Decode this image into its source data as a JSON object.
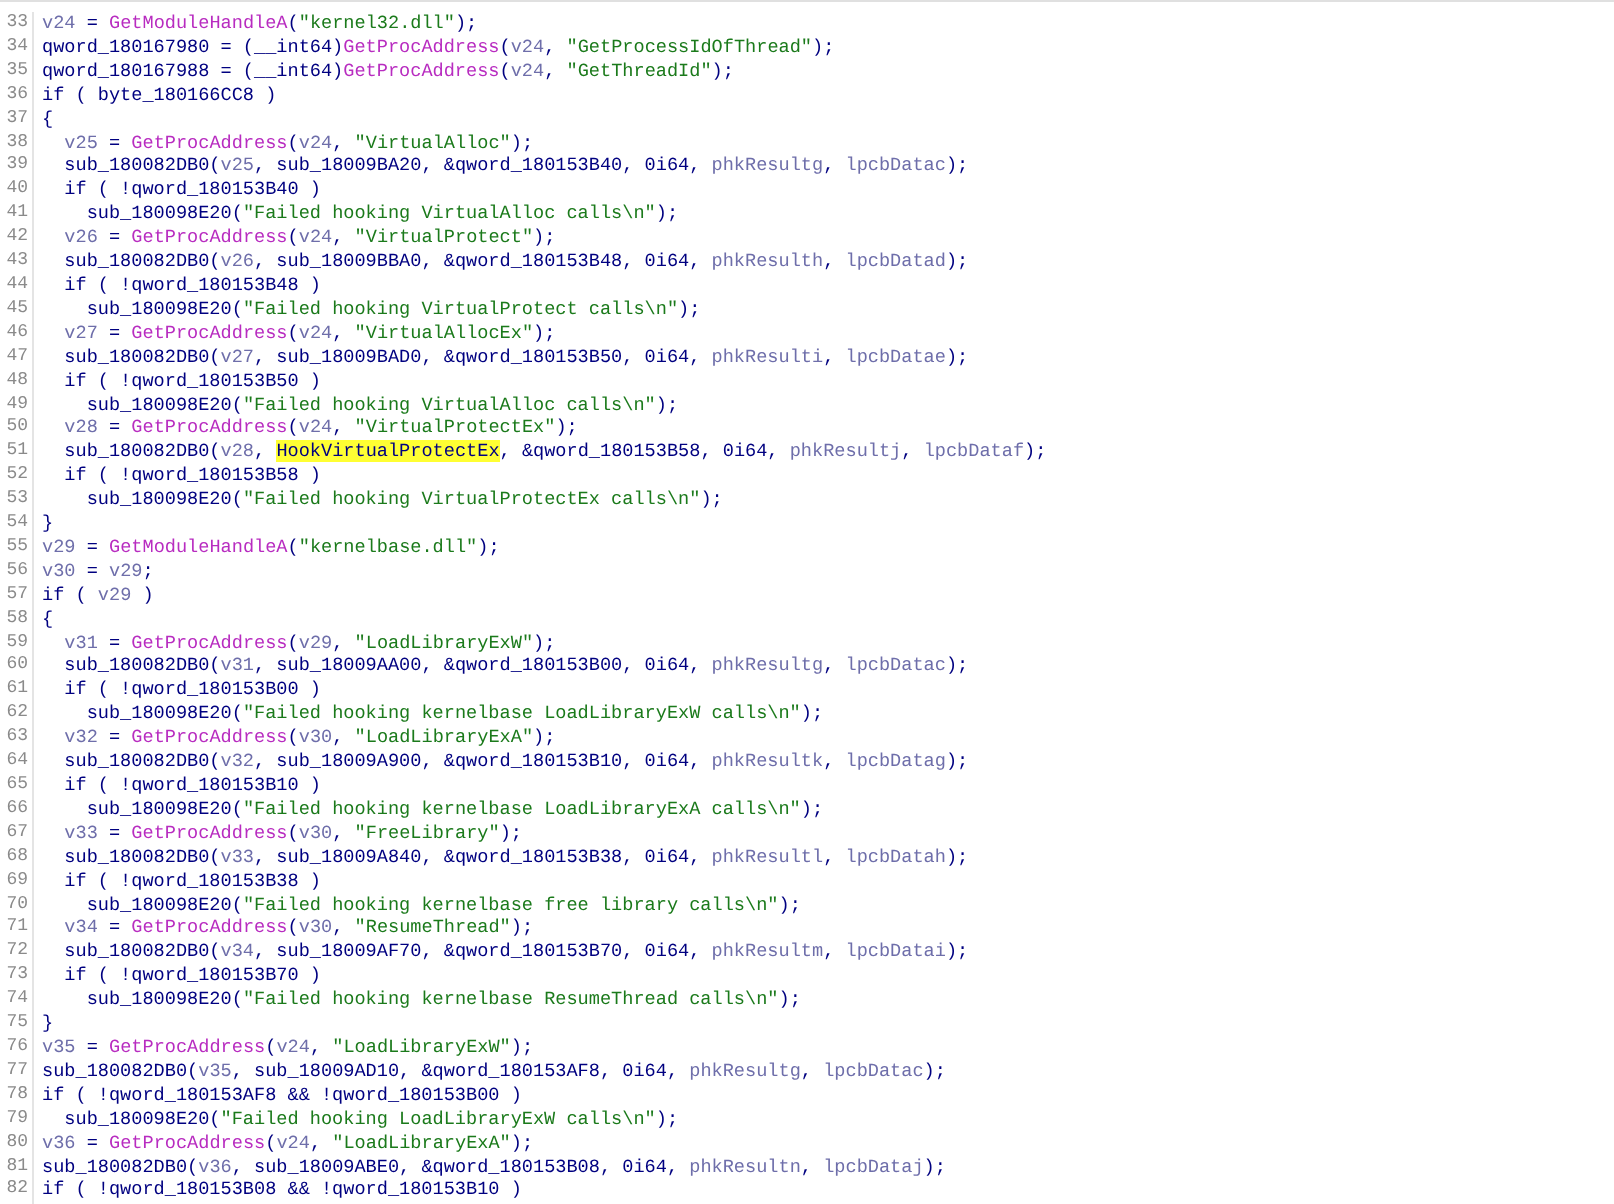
{
  "lines": [
    {
      "number": "33",
      "tokens": [
        {
          "kind": "local",
          "text": "v24"
        },
        {
          "kind": "plain",
          "text": " = "
        },
        {
          "kind": "func",
          "text": "GetModuleHandleA"
        },
        {
          "kind": "plain",
          "text": "("
        },
        {
          "kind": "string",
          "text": "\"kernel32.dll\""
        },
        {
          "kind": "plain",
          "text": ");"
        }
      ]
    },
    {
      "number": "34",
      "tokens": [
        {
          "kind": "plain",
          "text": "qword_180167980 = (__int64)"
        },
        {
          "kind": "func",
          "text": "GetProcAddress"
        },
        {
          "kind": "plain",
          "text": "("
        },
        {
          "kind": "local",
          "text": "v24"
        },
        {
          "kind": "plain",
          "text": ", "
        },
        {
          "kind": "string",
          "text": "\"GetProcessIdOfThread\""
        },
        {
          "kind": "plain",
          "text": ");"
        }
      ]
    },
    {
      "number": "35",
      "tokens": [
        {
          "kind": "plain",
          "text": "qword_180167988 = (__int64)"
        },
        {
          "kind": "func",
          "text": "GetProcAddress"
        },
        {
          "kind": "plain",
          "text": "("
        },
        {
          "kind": "local",
          "text": "v24"
        },
        {
          "kind": "plain",
          "text": ", "
        },
        {
          "kind": "string",
          "text": "\"GetThreadId\""
        },
        {
          "kind": "plain",
          "text": ");"
        }
      ]
    },
    {
      "number": "36",
      "tokens": [
        {
          "kind": "plain",
          "text": "if ( byte_180166CC8 )"
        }
      ]
    },
    {
      "number": "37",
      "tokens": [
        {
          "kind": "plain",
          "text": "{"
        }
      ]
    },
    {
      "number": "38",
      "tokens": [
        {
          "kind": "local",
          "text": "  v25"
        },
        {
          "kind": "plain",
          "text": " = "
        },
        {
          "kind": "func",
          "text": "GetProcAddress"
        },
        {
          "kind": "plain",
          "text": "("
        },
        {
          "kind": "local",
          "text": "v24"
        },
        {
          "kind": "plain",
          "text": ", "
        },
        {
          "kind": "string",
          "text": "\"VirtualAlloc\""
        },
        {
          "kind": "plain",
          "text": ");"
        }
      ]
    },
    {
      "number": "39",
      "tokens": [
        {
          "kind": "plain",
          "text": "  sub_180082DB0("
        },
        {
          "kind": "local",
          "text": "v25"
        },
        {
          "kind": "plain",
          "text": ", sub_18009BA20, &qword_180153B40, 0i64, "
        },
        {
          "kind": "local",
          "text": "phkResultg"
        },
        {
          "kind": "plain",
          "text": ", "
        },
        {
          "kind": "local",
          "text": "lpcbDatac"
        },
        {
          "kind": "plain",
          "text": ");"
        }
      ]
    },
    {
      "number": "40",
      "tokens": [
        {
          "kind": "plain",
          "text": "  if ( !qword_180153B40 )"
        }
      ]
    },
    {
      "number": "41",
      "tokens": [
        {
          "kind": "plain",
          "text": "    sub_180098E20("
        },
        {
          "kind": "string",
          "text": "\"Failed hooking VirtualAlloc calls\\n\""
        },
        {
          "kind": "plain",
          "text": ");"
        }
      ]
    },
    {
      "number": "42",
      "tokens": [
        {
          "kind": "local",
          "text": "  v26"
        },
        {
          "kind": "plain",
          "text": " = "
        },
        {
          "kind": "func",
          "text": "GetProcAddress"
        },
        {
          "kind": "plain",
          "text": "("
        },
        {
          "kind": "local",
          "text": "v24"
        },
        {
          "kind": "plain",
          "text": ", "
        },
        {
          "kind": "string",
          "text": "\"VirtualProtect\""
        },
        {
          "kind": "plain",
          "text": ");"
        }
      ]
    },
    {
      "number": "43",
      "tokens": [
        {
          "kind": "plain",
          "text": "  sub_180082DB0("
        },
        {
          "kind": "local",
          "text": "v26"
        },
        {
          "kind": "plain",
          "text": ", sub_18009BBA0, &qword_180153B48, 0i64, "
        },
        {
          "kind": "local",
          "text": "phkResulth"
        },
        {
          "kind": "plain",
          "text": ", "
        },
        {
          "kind": "local",
          "text": "lpcbDatad"
        },
        {
          "kind": "plain",
          "text": ");"
        }
      ]
    },
    {
      "number": "44",
      "tokens": [
        {
          "kind": "plain",
          "text": "  if ( !qword_180153B48 )"
        }
      ]
    },
    {
      "number": "45",
      "tokens": [
        {
          "kind": "plain",
          "text": "    sub_180098E20("
        },
        {
          "kind": "string",
          "text": "\"Failed hooking VirtualProtect calls\\n\""
        },
        {
          "kind": "plain",
          "text": ");"
        }
      ]
    },
    {
      "number": "46",
      "tokens": [
        {
          "kind": "local",
          "text": "  v27"
        },
        {
          "kind": "plain",
          "text": " = "
        },
        {
          "kind": "func",
          "text": "GetProcAddress"
        },
        {
          "kind": "plain",
          "text": "("
        },
        {
          "kind": "local",
          "text": "v24"
        },
        {
          "kind": "plain",
          "text": ", "
        },
        {
          "kind": "string",
          "text": "\"VirtualAllocEx\""
        },
        {
          "kind": "plain",
          "text": ");"
        }
      ]
    },
    {
      "number": "47",
      "tokens": [
        {
          "kind": "plain",
          "text": "  sub_180082DB0("
        },
        {
          "kind": "local",
          "text": "v27"
        },
        {
          "kind": "plain",
          "text": ", sub_18009BAD0, &qword_180153B50, 0i64, "
        },
        {
          "kind": "local",
          "text": "phkResulti"
        },
        {
          "kind": "plain",
          "text": ", "
        },
        {
          "kind": "local",
          "text": "lpcbDatae"
        },
        {
          "kind": "plain",
          "text": ");"
        }
      ]
    },
    {
      "number": "48",
      "tokens": [
        {
          "kind": "plain",
          "text": "  if ( !qword_180153B50 )"
        }
      ]
    },
    {
      "number": "49",
      "tokens": [
        {
          "kind": "plain",
          "text": "    sub_180098E20("
        },
        {
          "kind": "string",
          "text": "\"Failed hooking VirtualAlloc calls\\n\""
        },
        {
          "kind": "plain",
          "text": ");"
        }
      ]
    },
    {
      "number": "50",
      "tokens": [
        {
          "kind": "local",
          "text": "  v28"
        },
        {
          "kind": "plain",
          "text": " = "
        },
        {
          "kind": "func",
          "text": "GetProcAddress"
        },
        {
          "kind": "plain",
          "text": "("
        },
        {
          "kind": "local",
          "text": "v24"
        },
        {
          "kind": "plain",
          "text": ", "
        },
        {
          "kind": "string",
          "text": "\"VirtualProtectEx\""
        },
        {
          "kind": "plain",
          "text": ");"
        }
      ]
    },
    {
      "number": "51",
      "tokens": [
        {
          "kind": "plain",
          "text": "  sub_180082DB0("
        },
        {
          "kind": "local",
          "text": "v28"
        },
        {
          "kind": "plain",
          "text": ", "
        },
        {
          "kind": "highlight",
          "text": "HookVirtualProtectEx"
        },
        {
          "kind": "plain",
          "text": ", &qword_180153B58, 0i64, "
        },
        {
          "kind": "local",
          "text": "phkResultj"
        },
        {
          "kind": "plain",
          "text": ", "
        },
        {
          "kind": "local",
          "text": "lpcbDataf"
        },
        {
          "kind": "plain",
          "text": ");"
        }
      ]
    },
    {
      "number": "52",
      "tokens": [
        {
          "kind": "plain",
          "text": "  if ( !qword_180153B58 )"
        }
      ]
    },
    {
      "number": "53",
      "tokens": [
        {
          "kind": "plain",
          "text": "    sub_180098E20("
        },
        {
          "kind": "string",
          "text": "\"Failed hooking VirtualProtectEx calls\\n\""
        },
        {
          "kind": "plain",
          "text": ");"
        }
      ]
    },
    {
      "number": "54",
      "tokens": [
        {
          "kind": "plain",
          "text": "}"
        }
      ]
    },
    {
      "number": "55",
      "tokens": [
        {
          "kind": "local",
          "text": "v29"
        },
        {
          "kind": "plain",
          "text": " = "
        },
        {
          "kind": "func",
          "text": "GetModuleHandleA"
        },
        {
          "kind": "plain",
          "text": "("
        },
        {
          "kind": "string",
          "text": "\"kernelbase.dll\""
        },
        {
          "kind": "plain",
          "text": ");"
        }
      ]
    },
    {
      "number": "56",
      "tokens": [
        {
          "kind": "local",
          "text": "v30"
        },
        {
          "kind": "plain",
          "text": " = "
        },
        {
          "kind": "local",
          "text": "v29"
        },
        {
          "kind": "plain",
          "text": ";"
        }
      ]
    },
    {
      "number": "57",
      "tokens": [
        {
          "kind": "plain",
          "text": "if ( "
        },
        {
          "kind": "local",
          "text": "v29"
        },
        {
          "kind": "plain",
          "text": " )"
        }
      ]
    },
    {
      "number": "58",
      "tokens": [
        {
          "kind": "plain",
          "text": "{"
        }
      ]
    },
    {
      "number": "59",
      "tokens": [
        {
          "kind": "local",
          "text": "  v31"
        },
        {
          "kind": "plain",
          "text": " = "
        },
        {
          "kind": "func",
          "text": "GetProcAddress"
        },
        {
          "kind": "plain",
          "text": "("
        },
        {
          "kind": "local",
          "text": "v29"
        },
        {
          "kind": "plain",
          "text": ", "
        },
        {
          "kind": "string",
          "text": "\"LoadLibraryExW\""
        },
        {
          "kind": "plain",
          "text": ");"
        }
      ]
    },
    {
      "number": "60",
      "tokens": [
        {
          "kind": "plain",
          "text": "  sub_180082DB0("
        },
        {
          "kind": "local",
          "text": "v31"
        },
        {
          "kind": "plain",
          "text": ", sub_18009AA00, &qword_180153B00, 0i64, "
        },
        {
          "kind": "local",
          "text": "phkResultg"
        },
        {
          "kind": "plain",
          "text": ", "
        },
        {
          "kind": "local",
          "text": "lpcbDatac"
        },
        {
          "kind": "plain",
          "text": ");"
        }
      ]
    },
    {
      "number": "61",
      "tokens": [
        {
          "kind": "plain",
          "text": "  if ( !qword_180153B00 )"
        }
      ]
    },
    {
      "number": "62",
      "tokens": [
        {
          "kind": "plain",
          "text": "    sub_180098E20("
        },
        {
          "kind": "string",
          "text": "\"Failed hooking kernelbase LoadLibraryExW calls\\n\""
        },
        {
          "kind": "plain",
          "text": ");"
        }
      ]
    },
    {
      "number": "63",
      "tokens": [
        {
          "kind": "local",
          "text": "  v32"
        },
        {
          "kind": "plain",
          "text": " = "
        },
        {
          "kind": "func",
          "text": "GetProcAddress"
        },
        {
          "kind": "plain",
          "text": "("
        },
        {
          "kind": "local",
          "text": "v30"
        },
        {
          "kind": "plain",
          "text": ", "
        },
        {
          "kind": "string",
          "text": "\"LoadLibraryExA\""
        },
        {
          "kind": "plain",
          "text": ");"
        }
      ]
    },
    {
      "number": "64",
      "tokens": [
        {
          "kind": "plain",
          "text": "  sub_180082DB0("
        },
        {
          "kind": "local",
          "text": "v32"
        },
        {
          "kind": "plain",
          "text": ", sub_18009A900, &qword_180153B10, 0i64, "
        },
        {
          "kind": "local",
          "text": "phkResultk"
        },
        {
          "kind": "plain",
          "text": ", "
        },
        {
          "kind": "local",
          "text": "lpcbDatag"
        },
        {
          "kind": "plain",
          "text": ");"
        }
      ]
    },
    {
      "number": "65",
      "tokens": [
        {
          "kind": "plain",
          "text": "  if ( !qword_180153B10 )"
        }
      ]
    },
    {
      "number": "66",
      "tokens": [
        {
          "kind": "plain",
          "text": "    sub_180098E20("
        },
        {
          "kind": "string",
          "text": "\"Failed hooking kernelbase LoadLibraryExA calls\\n\""
        },
        {
          "kind": "plain",
          "text": ");"
        }
      ]
    },
    {
      "number": "67",
      "tokens": [
        {
          "kind": "local",
          "text": "  v33"
        },
        {
          "kind": "plain",
          "text": " = "
        },
        {
          "kind": "func",
          "text": "GetProcAddress"
        },
        {
          "kind": "plain",
          "text": "("
        },
        {
          "kind": "local",
          "text": "v30"
        },
        {
          "kind": "plain",
          "text": ", "
        },
        {
          "kind": "string",
          "text": "\"FreeLibrary\""
        },
        {
          "kind": "plain",
          "text": ");"
        }
      ]
    },
    {
      "number": "68",
      "tokens": [
        {
          "kind": "plain",
          "text": "  sub_180082DB0("
        },
        {
          "kind": "local",
          "text": "v33"
        },
        {
          "kind": "plain",
          "text": ", sub_18009A840, &qword_180153B38, 0i64, "
        },
        {
          "kind": "local",
          "text": "phkResultl"
        },
        {
          "kind": "plain",
          "text": ", "
        },
        {
          "kind": "local",
          "text": "lpcbDatah"
        },
        {
          "kind": "plain",
          "text": ");"
        }
      ]
    },
    {
      "number": "69",
      "tokens": [
        {
          "kind": "plain",
          "text": "  if ( !qword_180153B38 )"
        }
      ]
    },
    {
      "number": "70",
      "tokens": [
        {
          "kind": "plain",
          "text": "    sub_180098E20("
        },
        {
          "kind": "string",
          "text": "\"Failed hooking kernelbase free library calls\\n\""
        },
        {
          "kind": "plain",
          "text": ");"
        }
      ]
    },
    {
      "number": "71",
      "tokens": [
        {
          "kind": "local",
          "text": "  v34"
        },
        {
          "kind": "plain",
          "text": " = "
        },
        {
          "kind": "func",
          "text": "GetProcAddress"
        },
        {
          "kind": "plain",
          "text": "("
        },
        {
          "kind": "local",
          "text": "v30"
        },
        {
          "kind": "plain",
          "text": ", "
        },
        {
          "kind": "string",
          "text": "\"ResumeThread\""
        },
        {
          "kind": "plain",
          "text": ");"
        }
      ]
    },
    {
      "number": "72",
      "tokens": [
        {
          "kind": "plain",
          "text": "  sub_180082DB0("
        },
        {
          "kind": "local",
          "text": "v34"
        },
        {
          "kind": "plain",
          "text": ", sub_18009AF70, &qword_180153B70, 0i64, "
        },
        {
          "kind": "local",
          "text": "phkResultm"
        },
        {
          "kind": "plain",
          "text": ", "
        },
        {
          "kind": "local",
          "text": "lpcbDatai"
        },
        {
          "kind": "plain",
          "text": ");"
        }
      ]
    },
    {
      "number": "73",
      "tokens": [
        {
          "kind": "plain",
          "text": "  if ( !qword_180153B70 )"
        }
      ]
    },
    {
      "number": "74",
      "tokens": [
        {
          "kind": "plain",
          "text": "    sub_180098E20("
        },
        {
          "kind": "string",
          "text": "\"Failed hooking kernelbase ResumeThread calls\\n\""
        },
        {
          "kind": "plain",
          "text": ");"
        }
      ]
    },
    {
      "number": "75",
      "tokens": [
        {
          "kind": "plain",
          "text": "}"
        }
      ]
    },
    {
      "number": "76",
      "tokens": [
        {
          "kind": "local",
          "text": "v35"
        },
        {
          "kind": "plain",
          "text": " = "
        },
        {
          "kind": "func",
          "text": "GetProcAddress"
        },
        {
          "kind": "plain",
          "text": "("
        },
        {
          "kind": "local",
          "text": "v24"
        },
        {
          "kind": "plain",
          "text": ", "
        },
        {
          "kind": "string",
          "text": "\"LoadLibraryExW\""
        },
        {
          "kind": "plain",
          "text": ");"
        }
      ]
    },
    {
      "number": "77",
      "tokens": [
        {
          "kind": "plain",
          "text": "sub_180082DB0("
        },
        {
          "kind": "local",
          "text": "v35"
        },
        {
          "kind": "plain",
          "text": ", sub_18009AD10, &qword_180153AF8, 0i64, "
        },
        {
          "kind": "local",
          "text": "phkResultg"
        },
        {
          "kind": "plain",
          "text": ", "
        },
        {
          "kind": "local",
          "text": "lpcbDatac"
        },
        {
          "kind": "plain",
          "text": ");"
        }
      ]
    },
    {
      "number": "78",
      "tokens": [
        {
          "kind": "plain",
          "text": "if ( !qword_180153AF8 && !qword_180153B00 )"
        }
      ]
    },
    {
      "number": "79",
      "tokens": [
        {
          "kind": "plain",
          "text": "  sub_180098E20("
        },
        {
          "kind": "string",
          "text": "\"Failed hooking LoadLibraryExW calls\\n\""
        },
        {
          "kind": "plain",
          "text": ");"
        }
      ]
    },
    {
      "number": "80",
      "tokens": [
        {
          "kind": "local",
          "text": "v36"
        },
        {
          "kind": "plain",
          "text": " = "
        },
        {
          "kind": "func",
          "text": "GetProcAddress"
        },
        {
          "kind": "plain",
          "text": "("
        },
        {
          "kind": "local",
          "text": "v24"
        },
        {
          "kind": "plain",
          "text": ", "
        },
        {
          "kind": "string",
          "text": "\"LoadLibraryExA\""
        },
        {
          "kind": "plain",
          "text": ");"
        }
      ]
    },
    {
      "number": "81",
      "tokens": [
        {
          "kind": "plain",
          "text": "sub_180082DB0("
        },
        {
          "kind": "local",
          "text": "v36"
        },
        {
          "kind": "plain",
          "text": ", sub_18009ABE0, &qword_180153B08, 0i64, "
        },
        {
          "kind": "local",
          "text": "phkResultn"
        },
        {
          "kind": "plain",
          "text": ", "
        },
        {
          "kind": "local",
          "text": "lpcbDataj"
        },
        {
          "kind": "plain",
          "text": ");"
        }
      ]
    },
    {
      "number": "82",
      "tokens": [
        {
          "kind": "plain",
          "text": "if ( !qword_180153B08 && !qword_180153B10 )"
        }
      ]
    }
  ]
}
